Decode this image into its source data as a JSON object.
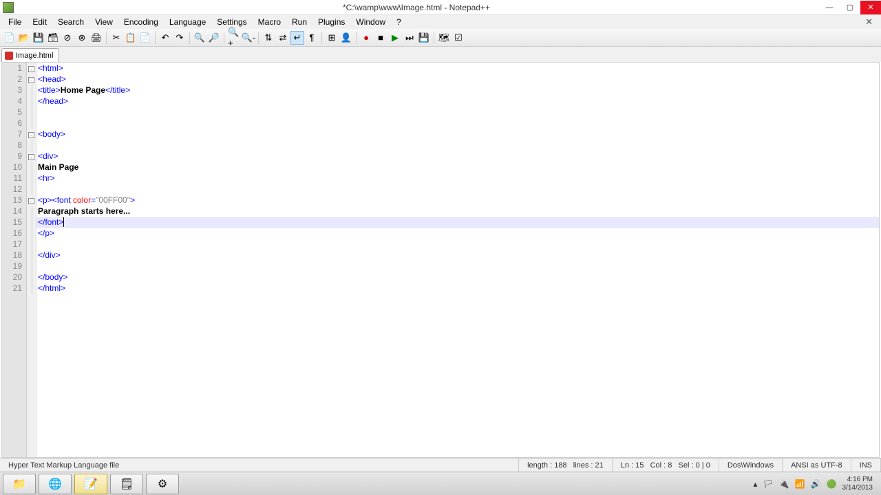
{
  "window": {
    "title": "*C:\\wamp\\www\\Image.html - Notepad++"
  },
  "menu": {
    "file": "File",
    "edit": "Edit",
    "search": "Search",
    "view": "View",
    "encoding": "Encoding",
    "language": "Language",
    "settings": "Settings",
    "macro": "Macro",
    "run": "Run",
    "plugins": "Plugins",
    "window": "Window",
    "help": "?"
  },
  "tab": {
    "label": "Image.html"
  },
  "code": {
    "l1_a": "<html>",
    "l2_a": "<head>",
    "l3_a": "<title>",
    "l3_b": "Home Page",
    "l3_c": "</title>",
    "l4_a": "</head>",
    "l7_a": "<body>",
    "l9_a": "<div>",
    "l10_a": "Main Page",
    "l11_a": "<hr>",
    "l13_a": "<p><font",
    "l13_b": " color",
    "l13_c": "=",
    "l13_d": "\"00FF00\"",
    "l13_e": ">",
    "l14_a": "Paragraph starts here...",
    "l15_a": "</font>",
    "l16_a": "</p>",
    "l18_a": "</div>",
    "l20_a": "</body>",
    "l21_a": "</html>"
  },
  "status": {
    "filetype": "Hyper Text Markup Language file",
    "length": "length : 188",
    "lines": "lines : 21",
    "ln": "Ln : 15",
    "col": "Col : 8",
    "sel": "Sel : 0 | 0",
    "eol": "Dos\\Windows",
    "encoding": "ANSI as UTF-8",
    "insmode": "INS"
  },
  "tray": {
    "time": "4:16 PM",
    "date": "3/14/2013"
  },
  "lines": [
    "1",
    "2",
    "3",
    "4",
    "5",
    "6",
    "7",
    "8",
    "9",
    "10",
    "11",
    "12",
    "13",
    "14",
    "15",
    "16",
    "17",
    "18",
    "19",
    "20",
    "21"
  ]
}
